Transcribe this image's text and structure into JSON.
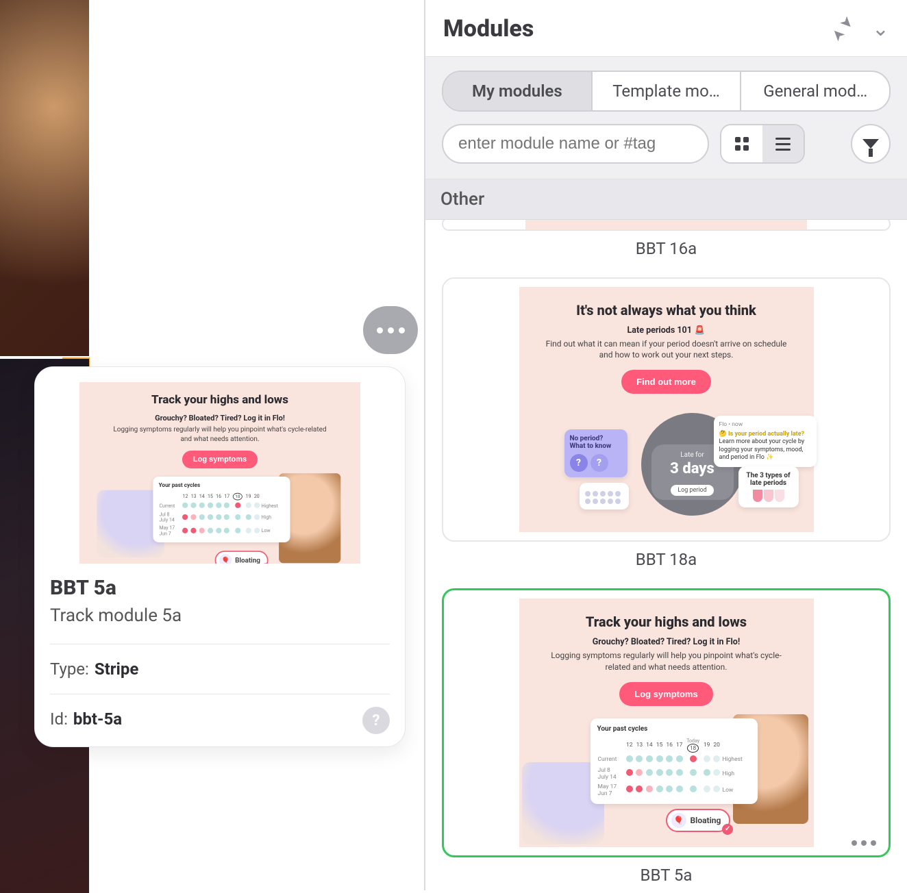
{
  "panel": {
    "title": "Modules",
    "tabs": [
      "My modules",
      "Template mo…",
      "General mod…"
    ],
    "active_tab": 0,
    "search_placeholder": "enter module name or #tag",
    "section": "Other"
  },
  "modules": {
    "m16": {
      "label": "BBT 16a"
    },
    "m18": {
      "label": "BBT 18a",
      "title": "It's not always what you think",
      "subtitle": "Late periods 101",
      "siren": "🚨",
      "desc": "Find out what it can mean if your period doesn't arrive on schedule and how to work out your next steps.",
      "cta": "Find out more",
      "tile_purple_l1": "No period?",
      "tile_purple_l2": "What to know",
      "late_small": "Late for",
      "late_big": "3 days",
      "log_period": "Log period",
      "note_src": "Flo • now",
      "note_hl": "Is your period actually late?",
      "note_body": "Learn more about your cycle by logging your symptoms, mood, and period in Flo ✨",
      "types_l1": "The 3 types of",
      "types_l2": "late periods"
    },
    "m5": {
      "label": "BBT 5a",
      "title": "Track your highs and lows",
      "sub": "Grouchy? Bloated? Tired? Log it in Flo!",
      "desc": "Logging symptoms regularly will help you pinpoint what's cycle-related and what needs attention.",
      "cta": "Log symptoms",
      "past": "Your past cycles",
      "today": "Today",
      "today_n": "18",
      "cols": [
        "12",
        "13",
        "14",
        "15",
        "16",
        "17",
        "18",
        "19",
        "20"
      ],
      "rows": [
        {
          "l": "Current",
          "r": "Highest"
        },
        {
          "l": "Jul 8\nJuly 14",
          "r": "High"
        },
        {
          "l": "May 17\nJun 7",
          "r": "Low"
        }
      ],
      "bloating": "Bloating"
    }
  },
  "popover": {
    "title": "BBT 5a",
    "subtitle": "Track module 5a",
    "type_label": "Type:",
    "type_value": "Stripe",
    "id_label": "Id:",
    "id_value": "bbt-5a"
  }
}
